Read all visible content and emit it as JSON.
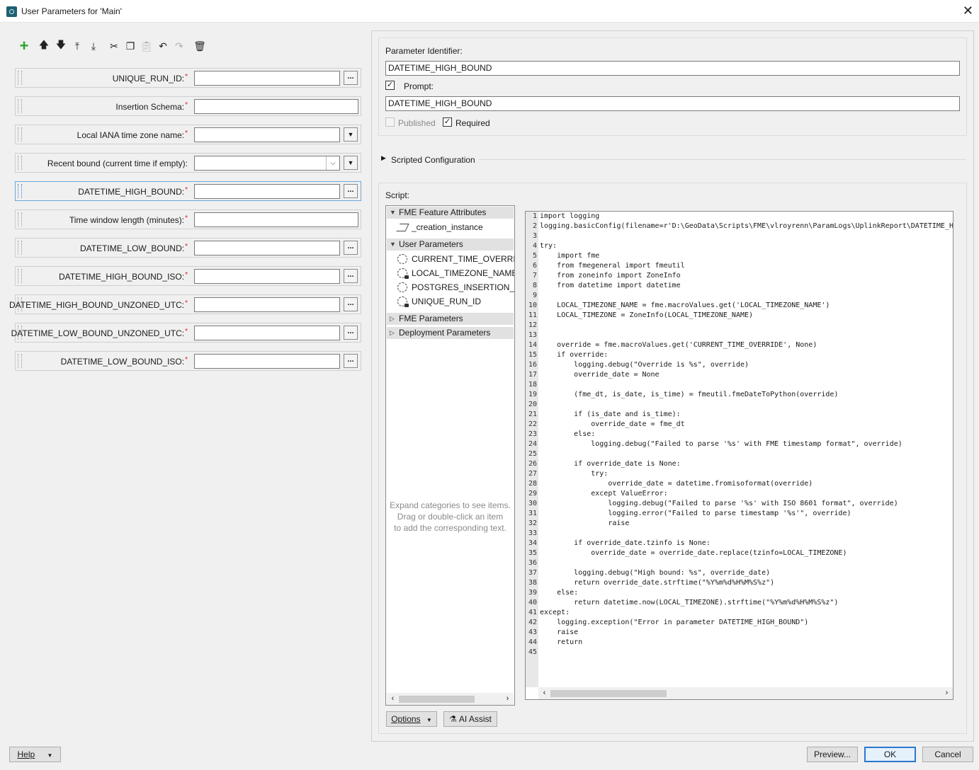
{
  "window": {
    "title": "User Parameters for 'Main'"
  },
  "toolbar": {
    "add_icon": "plus-icon",
    "icons": [
      "arrow-up-icon",
      "arrow-down-icon",
      "move-top-icon",
      "move-bottom-icon",
      "cut-icon",
      "copy-icon",
      "paste-icon",
      "undo-icon",
      "redo-icon",
      "delete-icon"
    ]
  },
  "parameters": [
    {
      "label": "UNIQUE_RUN_ID:",
      "required": "*",
      "button": "..."
    },
    {
      "label": "Insertion Schema:",
      "required": "*"
    },
    {
      "label": "Local IANA time zone name:",
      "required": "*",
      "button": "▼"
    },
    {
      "label": "Recent bound (current time if empty):",
      "required": "",
      "inner": "⌵",
      "button": "▼"
    },
    {
      "label": "DATETIME_HIGH_BOUND:",
      "required": "*",
      "button": "..."
    },
    {
      "label": "Time window length (minutes):",
      "required": "*"
    },
    {
      "label": "DATETIME_LOW_BOUND:",
      "required": "*",
      "button": "..."
    },
    {
      "label": "DATETIME_HIGH_BOUND_ISO:",
      "required": "*",
      "button": "..."
    },
    {
      "label": "DATETIME_HIGH_BOUND_UNZONED_UTC:",
      "required": "*",
      "button": "..."
    },
    {
      "label": "DATETIME_LOW_BOUND_UNZONED_UTC:",
      "required": "*",
      "button": "..."
    },
    {
      "label": "DATETIME_LOW_BOUND_ISO:",
      "required": "*",
      "button": "..."
    }
  ],
  "details": {
    "identifier_label": "Parameter Identifier:",
    "identifier_value": "DATETIME_HIGH_BOUND",
    "prompt_label": "Prompt:",
    "prompt_checked": "✓",
    "prompt_value": "DATETIME_HIGH_BOUND",
    "published_label": "Published",
    "required_label": "Required",
    "required_checked": "✓",
    "scripted_config_label": "Scripted Configuration",
    "script_label": "Script:"
  },
  "tree": {
    "categories": {
      "fme_feature_attributes": "FME Feature Attributes",
      "user_parameters": "User Parameters",
      "fme_parameters": "FME Parameters",
      "deployment_parameters": "Deployment Parameters"
    },
    "feature_attributes": [
      "_creation_instance"
    ],
    "user_parameters": [
      "CURRENT_TIME_OVERRIDE",
      "LOCAL_TIMEZONE_NAME",
      "POSTGRES_INSERTION_SC...",
      "UNIQUE_RUN_ID"
    ],
    "hint_lines": [
      "Expand categories to see items.",
      "Drag or double-click an item",
      "to add the corresponding text."
    ]
  },
  "code": [
    "import logging",
    "logging.basicConfig(filename=r'D:\\GeoData\\Scripts\\FME\\vlroyrenn\\ParamLogs\\UplinkReport\\DATETIME_H",
    "",
    "try:",
    "    import fme",
    "    from fmegeneral import fmeutil",
    "    from zoneinfo import ZoneInfo",
    "    from datetime import datetime",
    "",
    "    LOCAL_TIMEZONE_NAME = fme.macroValues.get('LOCAL_TIMEZONE_NAME')",
    "    LOCAL_TIMEZONE = ZoneInfo(LOCAL_TIMEZONE_NAME)",
    "",
    "",
    "    override = fme.macroValues.get('CURRENT_TIME_OVERRIDE', None)",
    "    if override:",
    "        logging.debug(\"Override is %s\", override)",
    "        override_date = None",
    "",
    "        (fme_dt, is_date, is_time) = fmeutil.fmeDateToPython(override)",
    "",
    "        if (is_date and is_time):",
    "            override_date = fme_dt",
    "        else:",
    "            logging.debug(\"Failed to parse '%s' with FME timestamp format\", override)",
    "",
    "        if override_date is None:",
    "            try:",
    "                override_date = datetime.fromisoformat(override)",
    "            except ValueError:",
    "                logging.debug(\"Failed to parse '%s' with ISO 8601 format\", override)",
    "                logging.error(\"Failed to parse timestamp '%s'\", override)",
    "                raise",
    "",
    "        if override_date.tzinfo is None:",
    "            override_date = override_date.replace(tzinfo=LOCAL_TIMEZONE)",
    "",
    "        logging.debug(\"High bound: %s\", override_date)",
    "        return override_date.strftime(\"%Y%m%d%H%M%S%z\")",
    "    else:",
    "        return datetime.now(LOCAL_TIMEZONE).strftime(\"%Y%m%d%H%M%S%z\")",
    "except:",
    "    logging.exception(\"Error in parameter DATETIME_HIGH_BOUND\")",
    "    raise",
    "    return",
    ""
  ],
  "buttons": {
    "options": "Options",
    "ai_assist": "AI Assist",
    "help": "Help",
    "preview": "Preview...",
    "ok": "OK",
    "cancel": "Cancel"
  },
  "colors": {
    "accent": "#2b78d0",
    "required_star": "#d61f1f",
    "add_green": "#2aa52a"
  }
}
